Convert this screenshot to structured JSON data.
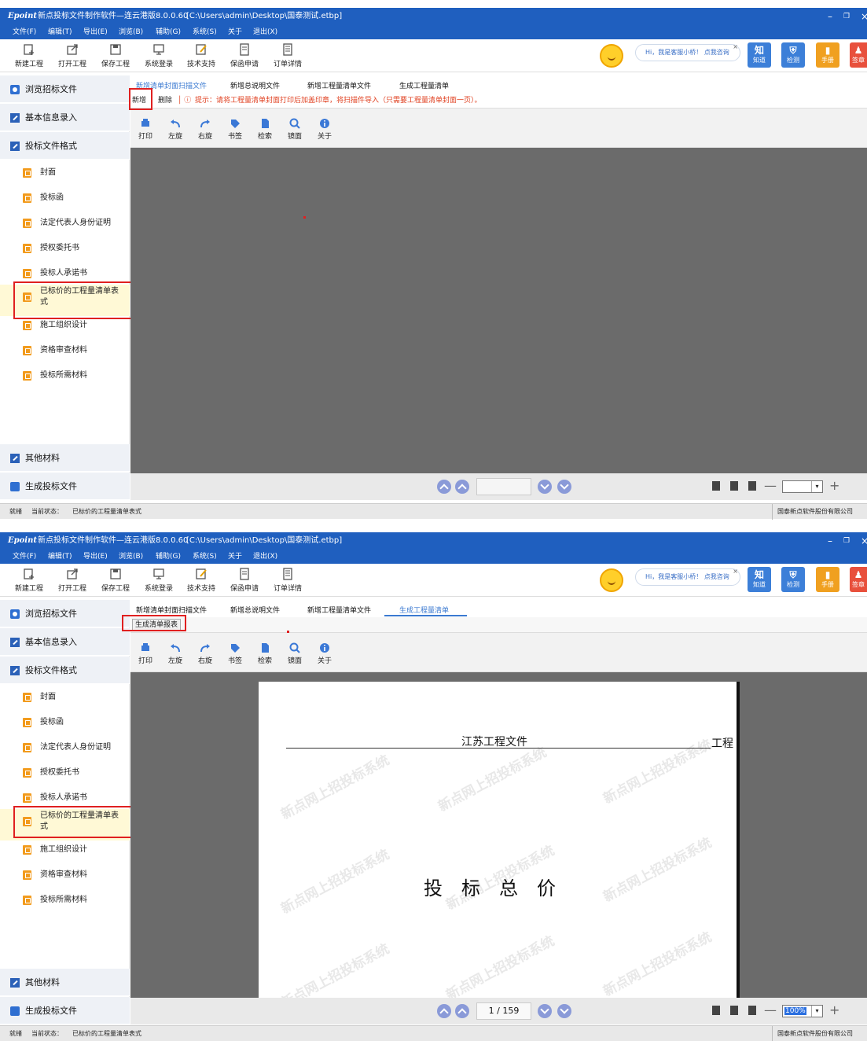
{
  "title_bar": {
    "brand": "Epoint",
    "title": "新点投标文件制作软件—连云港版8.0.0.60",
    "path": "[C:\\Users\\admin\\Desktop\\国泰测试.etbp]"
  },
  "menu": [
    "文件(F)",
    "编辑(T)",
    "导出(E)",
    "浏览(B)",
    "辅助(G)",
    "系统(S)",
    "关于",
    "退出(X)"
  ],
  "toolbar": [
    "新建工程",
    "打开工程",
    "保存工程",
    "系统登录",
    "技术支持",
    "保函申请",
    "订单详情"
  ],
  "helper": {
    "text": "Hi，我是客服小桥！",
    "link": "点我咨询"
  },
  "tiles": [
    {
      "glyph": "知",
      "label": "知道"
    },
    {
      "glyph": "⛨",
      "label": "检测"
    },
    {
      "glyph": "▮",
      "label": "手册"
    },
    {
      "glyph": "♟",
      "label": "签章"
    }
  ],
  "sidebar": {
    "browse": "浏览招标文件",
    "basic": "基本信息录入",
    "format": "投标文件格式",
    "items": [
      "封面",
      "投标函",
      "法定代表人身份证明",
      "授权委托书",
      "投标人承诺书",
      "已标价的工程量清单表式",
      "施工组织设计",
      "资格审查材料",
      "投标所需材料"
    ],
    "other": "其他材料",
    "generate": "生成投标文件"
  },
  "tabs": [
    "新增清单封面扫描文件",
    "新增总说明文件",
    "新增工程量清单文件",
    "生成工程量清单"
  ],
  "panel1": {
    "add": "新增",
    "delete": "删除",
    "hint": "提示：请将工程量清单封面打印后加盖印章，将扫描件导入（只需要工程量清单封面一页）。"
  },
  "panel2": {
    "gen_report": "生成清单报表",
    "page": "1 / 159",
    "zoom": "100%"
  },
  "pdf_tools": [
    "打印",
    "左旋",
    "右旋",
    "书签",
    "检索",
    "镜面",
    "关于"
  ],
  "document": {
    "header": "江苏工程文件",
    "header_suffix": "工程",
    "title": "投　标　总　价",
    "watermark": "新点网上招投标系统"
  },
  "status": {
    "ready": "就绪",
    "state_label": "当前状态：",
    "state": "已标价的工程量清单表式",
    "company": "国泰新点软件股份有限公司"
  }
}
